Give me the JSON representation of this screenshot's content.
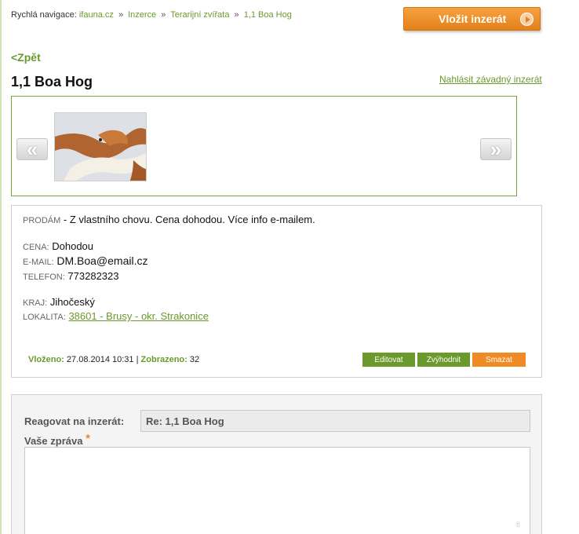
{
  "breadcrumb": {
    "label": "Rychlá navigace:",
    "items": [
      "ifauna.cz",
      "Inzerce",
      "Terarijní zvířata",
      "1,1 Boa Hog"
    ],
    "separator": "»"
  },
  "header": {
    "post_button": "Vložit inzerát"
  },
  "nav": {
    "back": "<Zpět"
  },
  "listing": {
    "title": "1,1 Boa Hog",
    "report_link": "Nahlásit závadný inzerát",
    "gallery": {
      "prev": "«",
      "next": "»",
      "thumbnail": "snake-photo"
    },
    "type_label": "PRODÁM",
    "description": "- Z vlastního chovu. Cena dohodou. Více info e-mailem.",
    "price_label": "CENA:",
    "price": "Dohodou",
    "email_label": "E-MAIL:",
    "email": "DM.Boa@email.cz",
    "phone_label": "TELEFON:",
    "phone": "773282323",
    "region_label": "KRAJ:",
    "region": "Jihočeský",
    "locality_label": "LOKALITA:",
    "locality": "38601 - Brusy - okr. Strakonice",
    "posted_label": "Vloženo:",
    "posted": "27.08.2014 10:31",
    "meta_sep": "|",
    "views_label": "Zobrazeno:",
    "views": "32",
    "actions": {
      "edit": "Editovat",
      "highlight": "Zvýhodnit",
      "delete": "Smazat"
    }
  },
  "reply": {
    "label": "Reagovat na inzerát:",
    "subject": "Re: 1,1 Boa Hog",
    "message_label": "Vaše zpráva",
    "required_mark": "*",
    "message": ""
  },
  "colors": {
    "accent_green": "#6a9a2c",
    "accent_orange": "#ef8a24",
    "border": "#cfcfcf"
  }
}
